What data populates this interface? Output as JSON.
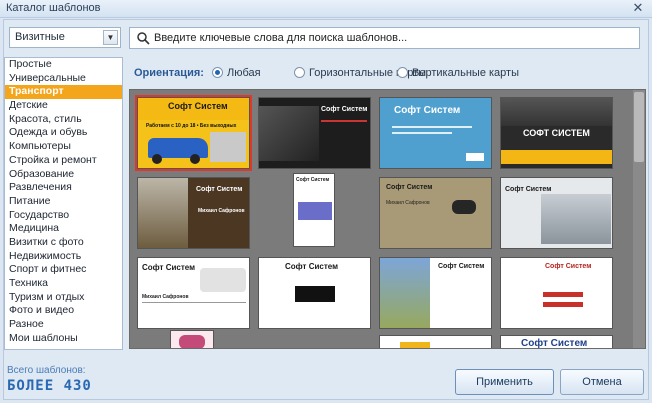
{
  "window": {
    "title": "Каталог шаблонов",
    "close_glyph": "✕"
  },
  "type_select": {
    "value": "Визитные"
  },
  "categories": [
    "Простые",
    "Универсальные",
    "Транспорт",
    "Детские",
    "Красота, стиль",
    "Одежда и обувь",
    "Компьютеры",
    "Стройка и ремонт",
    "Образование",
    "Развлечения",
    "Питание",
    "Государство",
    "Медицина",
    "Визитки с фото",
    "Недвижимость",
    "Спорт и фитнес",
    "Техника",
    "Туризм и отдых",
    "Фото и видео",
    "Разное",
    "Мои шаблоны"
  ],
  "selected_category": "Транспорт",
  "search": {
    "placeholder": "Введите ключевые слова для поиска шаблонов..."
  },
  "orientation": {
    "label": "Ориентация:",
    "options": [
      "Любая",
      "Горизонтальные карты",
      "Вертикальные карты"
    ],
    "selected": "Любая"
  },
  "cards": {
    "c1": {
      "title": "Софт Систем",
      "line1": "Работаем с 10 до 18 • Без выходных"
    },
    "c2": {
      "title": "Софт Систем"
    },
    "c3": {
      "title": "Софт Систем"
    },
    "c4": {
      "title": "СОФТ СИСТЕМ"
    },
    "c5": {
      "title": "Софт Систем",
      "name": "Михаил Сафронов"
    },
    "c6": {
      "title": "Софт Систем"
    },
    "c7": {
      "title": "Софт Систем",
      "name": "Михаил Сафронов"
    },
    "c8": {
      "title": "Софт Систем"
    },
    "c9": {
      "title": "Софт Систем",
      "name": "Михаил Сафронов"
    },
    "c10": {
      "title": "Софт Систем"
    },
    "c11": {
      "title": "Софт Систем"
    },
    "c12": {
      "title": "Софт Систем"
    },
    "c13": {
      "title": "Софт Систем"
    }
  },
  "footer": {
    "count_label": "Всего шаблонов:",
    "count_value": "БОЛЕЕ 430",
    "apply": "Применить",
    "cancel": "Отмена"
  },
  "colors": {
    "accent": "#f3a51c",
    "selected_border": "#d93a2b",
    "brand": "#2968b2"
  },
  "icons": [
    "search-icon",
    "chevron-down-icon",
    "close-icon"
  ]
}
